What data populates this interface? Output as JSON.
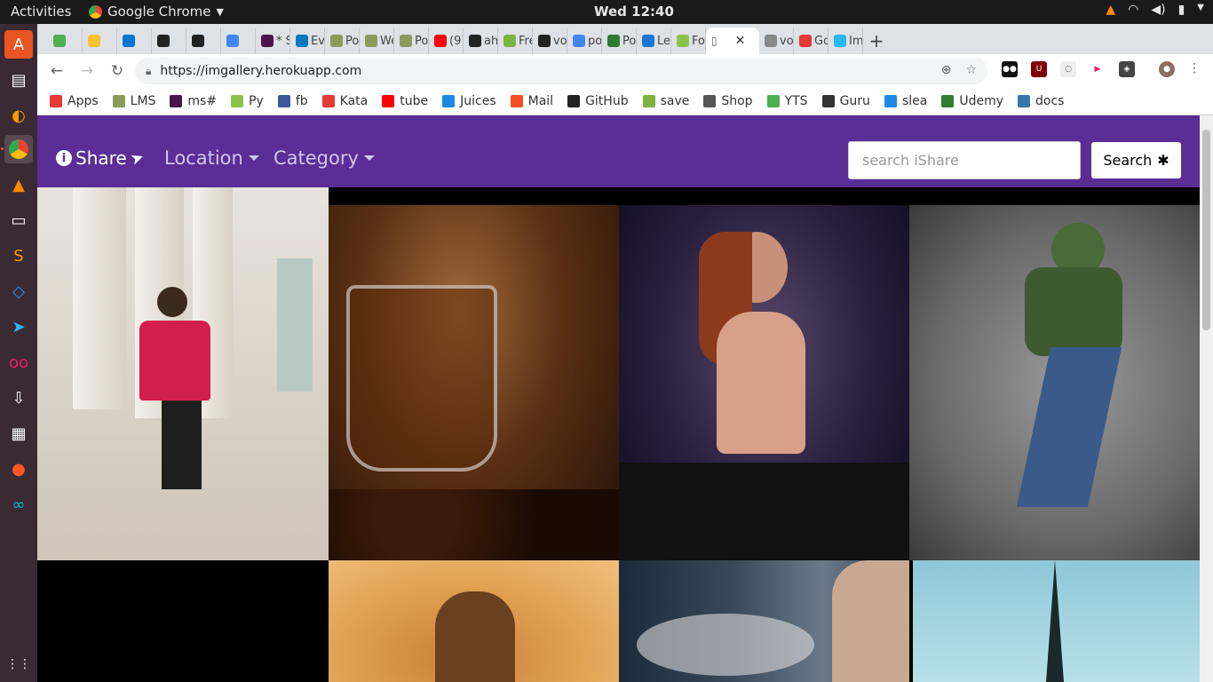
{
  "os": {
    "activities_label": "Activities",
    "app_name": "Google Chrome",
    "clock": "Wed 12:40"
  },
  "browser": {
    "tabs": [
      {
        "label": "",
        "color": "#4caf50"
      },
      {
        "label": "",
        "color": "#fbc02d"
      },
      {
        "label": "",
        "color": "#0078d4"
      },
      {
        "label": "",
        "color": "#222222"
      },
      {
        "label": "",
        "color": "#222222"
      },
      {
        "label": "",
        "color": "#4285f4"
      },
      {
        "label": "* S",
        "color": "#4a154b"
      },
      {
        "label": "Ev",
        "color": "#0079bf"
      },
      {
        "label": "Po",
        "color": "#8d9b5a"
      },
      {
        "label": "We",
        "color": "#8d9b5a"
      },
      {
        "label": "Po",
        "color": "#8d9b5a"
      },
      {
        "label": "(9)",
        "color": "#ff0000"
      },
      {
        "label": "ah",
        "color": "#222222"
      },
      {
        "label": "Fre",
        "color": "#7cb342"
      },
      {
        "label": "vo",
        "color": "#222222"
      },
      {
        "label": "po",
        "color": "#4285f4"
      },
      {
        "label": "Po",
        "color": "#2e7d32"
      },
      {
        "label": "Le",
        "color": "#1976d2"
      },
      {
        "label": "Fo",
        "color": "#8bc34a"
      }
    ],
    "active_tab": {
      "label": ""
    },
    "after_tabs": [
      {
        "label": "vo",
        "color": "#888888"
      },
      {
        "label": "Go",
        "color": "#e53935"
      },
      {
        "label": "Im",
        "color": "#29b6f6"
      }
    ],
    "new_tab_label": "+",
    "url": "https://imgallery.herokuapp.com",
    "bookmarks": [
      {
        "label": "Apps",
        "color": "#e53935"
      },
      {
        "label": "LMS",
        "color": "#8d9b5a"
      },
      {
        "label": "ms#",
        "color": "#4a154b"
      },
      {
        "label": "Py",
        "color": "#8bc34a"
      },
      {
        "label": "fb",
        "color": "#3b5998"
      },
      {
        "label": "Kata",
        "color": "#e53935"
      },
      {
        "label": "tube",
        "color": "#ff0000"
      },
      {
        "label": "Juices",
        "color": "#1e88e5"
      },
      {
        "label": "Mail",
        "color": "#f25022"
      },
      {
        "label": "GitHub",
        "color": "#222222"
      },
      {
        "label": "save",
        "color": "#7cb342"
      },
      {
        "label": "Shop",
        "color": "#555555"
      },
      {
        "label": "YTS",
        "color": "#4caf50"
      },
      {
        "label": "Guru",
        "color": "#333333"
      },
      {
        "label": "slea",
        "color": "#1e88e5"
      },
      {
        "label": "Udemy",
        "color": "#2e7d32"
      },
      {
        "label": "docs",
        "color": "#3776ab"
      }
    ]
  },
  "site": {
    "brand": "Share",
    "nav": {
      "location": "Location",
      "category": "Category"
    },
    "search": {
      "placeholder": "search iShare",
      "button_label": "Search"
    },
    "accent": "#5b2d97"
  },
  "gallery": {
    "images": [
      {
        "name": "man-in-red-sweater-photo"
      },
      {
        "name": "coffee-glass-photo"
      },
      {
        "name": "dj-woman-photo"
      },
      {
        "name": "dancer-photo"
      },
      {
        "name": "black-photo"
      },
      {
        "name": "astronaut-photo"
      },
      {
        "name": "smoking-man-photo"
      },
      {
        "name": "eiffel-tower-photo"
      }
    ]
  }
}
